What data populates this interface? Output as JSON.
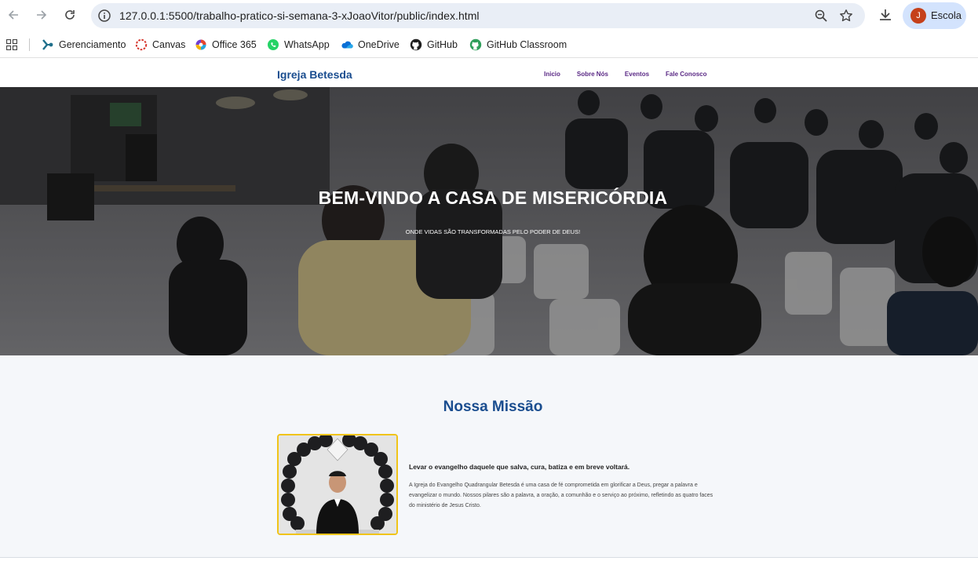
{
  "browser": {
    "url": "127.0.0.1:5500/trabalho-pratico-si-semana-3-xJoaoVitor/public/index.html",
    "profile_initial": "J",
    "profile_name": "Escola",
    "bookmarks": [
      {
        "label": "Gerenciamento",
        "icon": "gerenciamento-icon"
      },
      {
        "label": "Canvas",
        "icon": "canvas-icon"
      },
      {
        "label": "Office 365",
        "icon": "office-365-icon"
      },
      {
        "label": "WhatsApp",
        "icon": "whatsapp-icon"
      },
      {
        "label": "OneDrive",
        "icon": "onedrive-icon"
      },
      {
        "label": "GitHub",
        "icon": "github-icon"
      },
      {
        "label": "GitHub Classroom",
        "icon": "github-classroom-icon"
      }
    ]
  },
  "site": {
    "brand": "Igreja Betesda",
    "nav": [
      "Inicio",
      "Sobre Nós",
      "Eventos",
      "Fale Conosco"
    ]
  },
  "hero": {
    "title": "BEM-VINDO A CASA DE MISERICÓRDIA",
    "subtitle": "ONDE VIDAS SÃO TRANSFORMADAS PELO PODER DE DEUS!"
  },
  "mission": {
    "title": "Nossa Missão",
    "lead": "Levar o evangelho daquele que salva, cura, batiza e em breve voltará.",
    "text": "A Igreja do Evangelho Quadrangular Betesda é uma casa de fé comprometida em glorificar a Deus, pregar a palavra e evangelizar o mundo. Nossos pilares são a palavra, a oração, a comunhão e o serviço ao próximo, refletindo as quatro faces do ministério de Jesus Cristo."
  },
  "colors": {
    "brand": "#1a4d8f",
    "nav_link": "#5b2a86",
    "photo_border": "#f0c419",
    "omnibox": "#e9eef6",
    "profile_chip": "#d3e3fd"
  }
}
